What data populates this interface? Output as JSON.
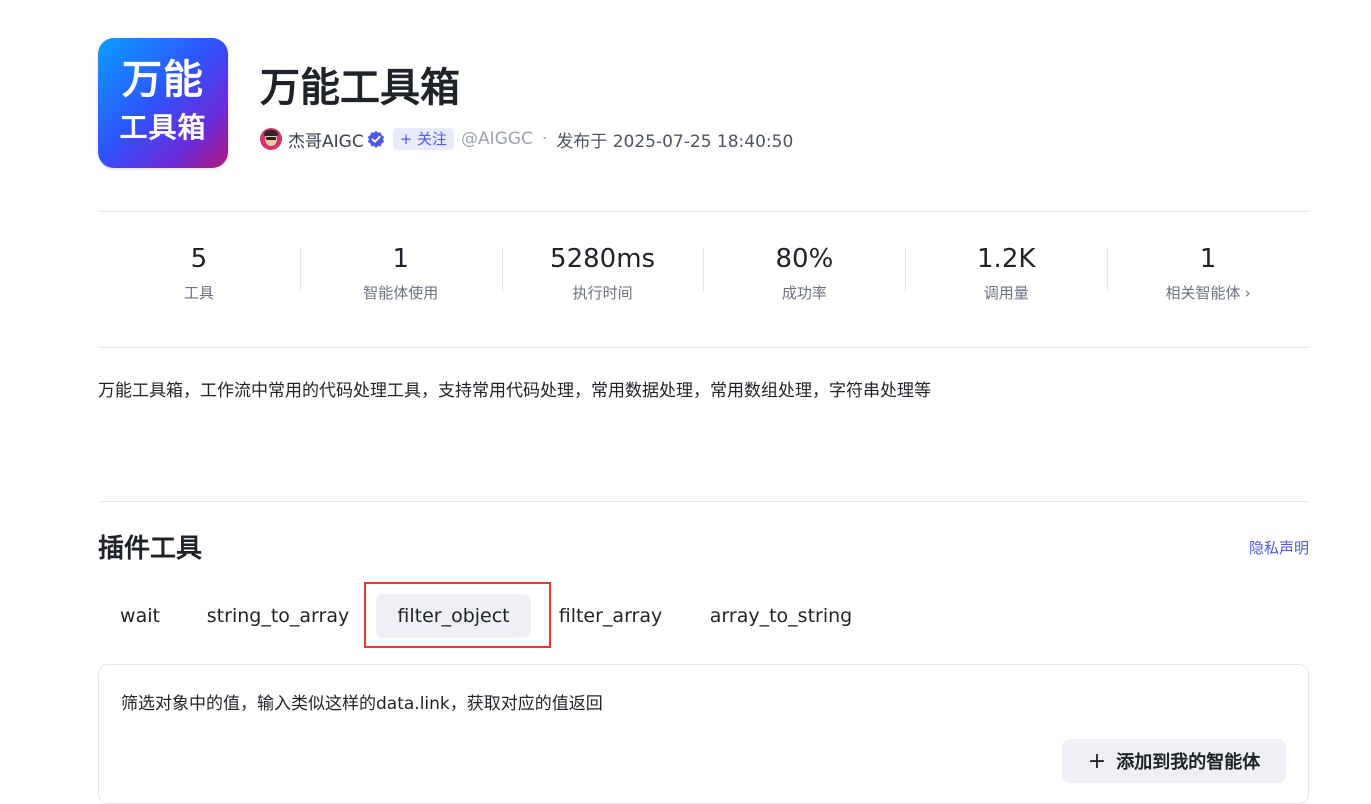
{
  "plugin": {
    "logo_line1": "万能",
    "logo_line2": "工具箱",
    "title": "万能工具箱",
    "author": "杰哥AIGC",
    "follow_label": "+ 关注",
    "handle": "@AIGGC",
    "separator": "·",
    "publish_text": "发布于 2025-07-25 18:40:50"
  },
  "stats": [
    {
      "value": "5",
      "label": "工具"
    },
    {
      "value": "1",
      "label": "智能体使用"
    },
    {
      "value": "5280ms",
      "label": "执行时间"
    },
    {
      "value": "80%",
      "label": "成功率"
    },
    {
      "value": "1.2K",
      "label": "调用量"
    },
    {
      "value": "1",
      "label": "相关智能体"
    }
  ],
  "description": "万能工具箱，工作流中常用的代码处理工具，支持常用代码处理，常用数据处理，常用数组处理，字符串处理等",
  "tools_section": {
    "title": "插件工具",
    "privacy_link": "隐私声明",
    "tabs": [
      "wait",
      "string_to_array",
      "filter_object",
      "filter_array",
      "array_to_string"
    ],
    "active_tab": "filter_object",
    "panel_description": "筛选对象中的值，输入类似这样的data.link，获取对应的值返回",
    "add_button_label": "添加到我的智能体"
  },
  "colors": {
    "accent": "#4e5ae6",
    "highlight_box": "#e53935",
    "verified_badge": "#4e5ae6"
  }
}
